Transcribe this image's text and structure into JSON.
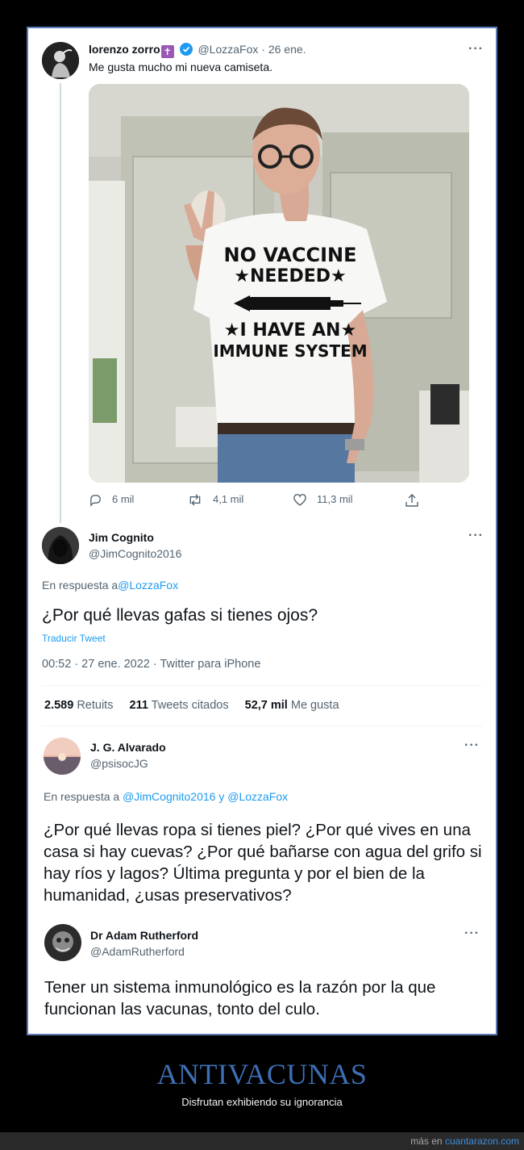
{
  "tweet1": {
    "name": "lorenzo zorro",
    "name_emoji": "✝",
    "handle": "@LozzaFox",
    "date": "26 ene.",
    "text": "Me gusta mucho mi nueva camiseta.",
    "shirt": {
      "line1": "NO VACCINE",
      "line2": "★NEEDED★",
      "line3": "★I HAVE AN★",
      "line4": "IMMUNE SYSTEM"
    },
    "replies": "6 mil",
    "retweets": "4,1 mil",
    "likes": "11,3 mil"
  },
  "tweet2": {
    "name": "Jim Cognito",
    "handle": "@JimCognito2016",
    "reply_prefix": "En respuesta a",
    "reply_to": "@LozzaFox",
    "text": "¿Por qué llevas gafas si tienes ojos?",
    "translate": "Traducir Tweet",
    "time": "00:52 · 27 ene. 2022",
    "source": "Twitter para iPhone",
    "retweets_count": "2.589",
    "retweets_label": "Retuits",
    "quotes_count": "211",
    "quotes_label": "Tweets citados",
    "likes_count": "52,7 mil",
    "likes_label": "Me gusta"
  },
  "tweet3": {
    "name": "J. G. Alvarado",
    "handle": "@psisocJG",
    "reply_prefix": "En respuesta a",
    "reply_to": "@JimCognito2016 y @LozzaFox",
    "text": "¿Por qué llevas ropa si tienes piel? ¿Por qué vives en una casa si hay cuevas? ¿Por qué bañarse con agua del grifo si hay ríos y lagos? Última pregunta y por el bien de la humanidad, ¿usas preservativos?"
  },
  "tweet4": {
    "name": "Dr Adam Rutherford",
    "handle": "@AdamRutherford",
    "text": "Tener un sistema inmunológico es la razón por la que funcionan las vacunas, tonto del culo."
  },
  "more_glyph": "···",
  "banner": {
    "title": "ANTIVACUNAS",
    "subtitle": "Disfrutan exhibiendo su ignorancia"
  },
  "footer": {
    "prefix": "más en",
    "site": "cuantarazon.com"
  },
  "colors": {
    "verified": "#1d9bf0",
    "link": "#1d9bf0",
    "banner_title": "#3d6fb6",
    "frame_border": "#5a7ab8"
  }
}
